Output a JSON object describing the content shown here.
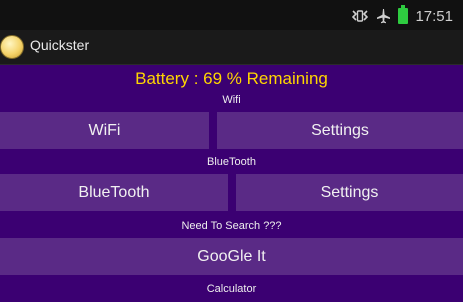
{
  "status_bar": {
    "time": "17:51",
    "icons": [
      "vibrate-icon",
      "airplane-mode-icon",
      "battery-icon"
    ]
  },
  "app": {
    "title": "Quickster"
  },
  "main": {
    "battery_text": "Battery : 69 %  Remaining",
    "sections": [
      {
        "label": "Wifi",
        "buttons": [
          "WiFi",
          "Settings"
        ]
      },
      {
        "label": "BlueTooth",
        "buttons": [
          "BlueTooth",
          "Settings"
        ]
      },
      {
        "label": "Need To Search ???",
        "buttons": [
          "GooGle It"
        ]
      },
      {
        "label": "Calculator",
        "buttons": []
      }
    ]
  }
}
